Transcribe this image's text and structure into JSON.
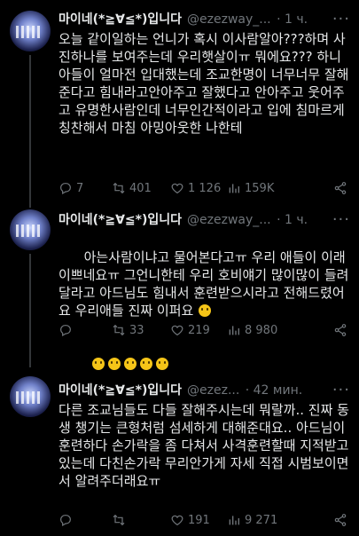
{
  "tweets": [
    {
      "name": "마이네(*≧∀≦*)입니다",
      "handle": "@ezezway_...",
      "time": "· 1 ч.",
      "text": "오늘 같이일하는 언니가 혹시 이사람알아???하며 사진하나를 보여주는데 우리햇살이ㅠ 뭐에요??? 하니 아들이 얼마전 입대했는데 조교한명이 너무너무 잘해준다고 힘내라고안아주고 잘했다고 안아주고 웃어주고 유명한사람인데 너무인간적이라고 입에 침마르게 칭찬해서 마침 아밍아웃한 나한테",
      "replies": "7",
      "retweets": "401",
      "likes": "1 126",
      "views": "159K"
    },
    {
      "name": "마이네(*≧∀≦*)입니다",
      "handle": "@ezezway_...",
      "time": "· 1 ч.",
      "text": "아는사람이냐고 물어본다고ㅠ 우리 애들이 이래 이쁘네요ㅠ 그언니한테 우리 호비얘기 많이많이 들려달라고 아드님도 힘내서 훈련받으시라고 전해드렸어요 우리애들 진짜 이퍼요",
      "emoji_count": 6,
      "replies": "",
      "retweets": "33",
      "likes": "219",
      "views": "8 980"
    },
    {
      "name": "마이네(*≧∀≦*)입니다",
      "handle": "@ezez...",
      "time": "· 42 мин.",
      "text": "다른 조교님들도 다들 잘해주시는데 뭐랄까.. 진짜 동생 챙기는 큰형처럼 섬세하게 대해준대요.. 아드님이 훈련하다 손가락을 좀 다쳐서 사격훈련할때 지적받고 있는데 다친손가락 무리안가게 자세 직접 시범보이면서 알려주더래요ㅠ",
      "replies": "",
      "retweets": "",
      "likes": "191",
      "views": "9 271"
    }
  ],
  "icons": [
    "reply-icon",
    "retweet-icon",
    "like-icon",
    "views-icon",
    "share-icon",
    "more-icon"
  ]
}
